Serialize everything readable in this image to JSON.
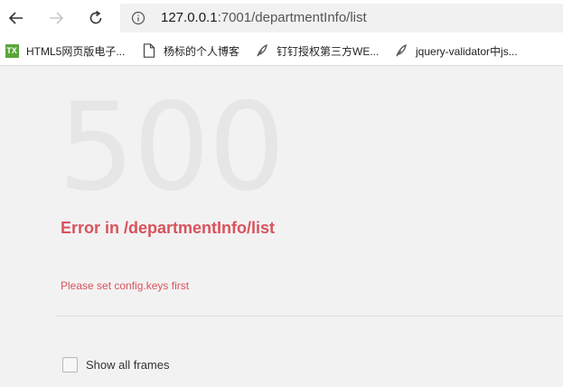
{
  "browser": {
    "url_host": "127.0.0.1",
    "url_rest": ":7001/departmentInfo/list",
    "icons": {
      "back": "back-arrow-icon",
      "forward": "forward-arrow-icon",
      "reload": "reload-icon",
      "info": "info-icon"
    }
  },
  "bookmarks": [
    {
      "label": "HTML5网页版电子...",
      "icon": "tx-favicon-icon"
    },
    {
      "label": "杨标的个人博客",
      "icon": "page-icon"
    },
    {
      "label": "钉钉授权第三方WE...",
      "icon": "feather-icon"
    },
    {
      "label": "jquery-validator中js...",
      "icon": "feather-icon"
    }
  ],
  "tx_favicon_text": "TX",
  "page": {
    "status_code": "500",
    "error_title": "Error in /departmentInfo/list",
    "error_message": "Please set config.keys first",
    "show_frames_label": "Show all frames",
    "show_frames_checked": false,
    "error_color": "#d8535d"
  }
}
